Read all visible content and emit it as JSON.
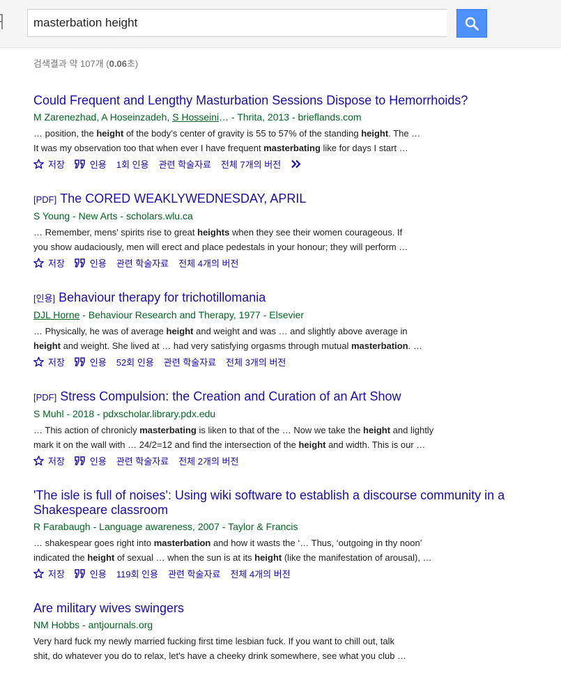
{
  "search": {
    "query": "masterbation height"
  },
  "stats": {
    "prefix": "검색결과 약 107개 (",
    "time": "0.06",
    "suffix": "초)"
  },
  "actions": {
    "save": "저장",
    "cite": "인용",
    "related": "관련 학술자료"
  },
  "results": [
    {
      "tag": "",
      "title": "Could Frequent and Lengthy Masturbation Sessions Dispose to Hemorrhoids?",
      "meta_pre": "M Zarenezhad, A Hoseinzadeh, ",
      "meta_link": "S Hosseini",
      "meta_post": "… - Thrita, 2013 - brieflands.com",
      "snippet1": [
        "… position, the ",
        "height",
        " of the body’s center of gravity is 55 to 57% of the standing ",
        "height",
        ". The …"
      ],
      "snippet2": [
        "It was my observation too that when ever I have frequent ",
        "masterbating",
        " like for days I start …",
        "",
        ""
      ],
      "cited_by": "1회 인용",
      "versions": "전체 7개의 버전"
    },
    {
      "tag": "[PDF]",
      "title": "The CORED WEAKLYWEDNESDAY, APRIL",
      "meta_pre": "S Young - New Arts - scholars.wlu.ca",
      "meta_link": "",
      "meta_post": "",
      "snippet1": [
        "… Remember, mens' spirits rise to great ",
        "heights",
        " when they see their women courageous. If",
        "",
        ""
      ],
      "snippet2": [
        "you show audaciously, men will erect and place pedestals in your honour; they will perform …",
        "",
        "",
        "",
        ""
      ],
      "cited_by": "",
      "versions": "전체 4개의 버전"
    },
    {
      "tag": "[인용]",
      "title": "Behaviour therapy for trichotillomania",
      "meta_pre": "",
      "meta_link": "DJL Horne",
      "meta_post": " - Behaviour Research and Therapy, 1977 - Elsevier",
      "snippet1": [
        "… Physically, he was of average ",
        "height",
        " and weight and was … and slightly above average in",
        "",
        ""
      ],
      "snippet2": [
        "",
        "height",
        " and weight. She lived at … had very satisfying orgasms through mutual ",
        "masterbation",
        ". …"
      ],
      "cited_by": "52회 인용",
      "versions": "전체 3개의 버전"
    },
    {
      "tag": "[PDF]",
      "title": "Stress Compulsion: the Creation and Curation of an Art Show",
      "meta_pre": "S Muhl - 2018 - pdxscholar.library.pdx.edu",
      "meta_link": "",
      "meta_post": "",
      "snippet1": [
        "… This action of chronicly ",
        "masterbating",
        " is liken to that of the … Now we take the ",
        "height",
        " and lightly"
      ],
      "snippet2": [
        "mark it on the wall with … 24/2=12 and find the intersection of the ",
        "height",
        " and width. This is our …",
        "",
        ""
      ],
      "cited_by": "",
      "versions": "전체 2개의 버전"
    },
    {
      "tag": "",
      "title": "'The isle is full of noises': Using wiki software to establish a discourse community in a Shakespeare classroom",
      "meta_pre": "R Farabaugh - Language awareness, 2007 - Taylor & Francis",
      "meta_link": "",
      "meta_post": "",
      "snippet1": [
        "… shakespear goes right into ",
        "masterbation",
        " and how it wasts the ‘… Thus, ‘outgoing in thy noon’",
        "",
        ""
      ],
      "snippet2": [
        "indicated the ",
        "height",
        " of sexual … when the sun is at its ",
        "height",
        " (like the manifestation of arousal), …"
      ],
      "cited_by": "119회 인용",
      "versions": "전체 4개의 버전"
    },
    {
      "tag": "",
      "title": "Are military wives swingers",
      "meta_pre": "NM Hobbs - antjournals.org",
      "meta_link": "",
      "meta_post": "",
      "snippet1": [
        "Very hard fuck my newly married fucking first time lesbian fuck. If you want to chill out, talk",
        "",
        "",
        "",
        ""
      ],
      "snippet2": [
        "shit, do whatever you do to relax, let's have a cheeky drink somewhere, see what you club …",
        "",
        "",
        "",
        ""
      ],
      "cited_by": "",
      "versions": ""
    }
  ],
  "colors": {
    "title_link": "#1a0dab",
    "meta_green": "#006621",
    "search_button": "#4d90fe"
  },
  "icons": [
    "search-icon",
    "star-icon",
    "quote-icon",
    "double-chevron-right-icon"
  ]
}
